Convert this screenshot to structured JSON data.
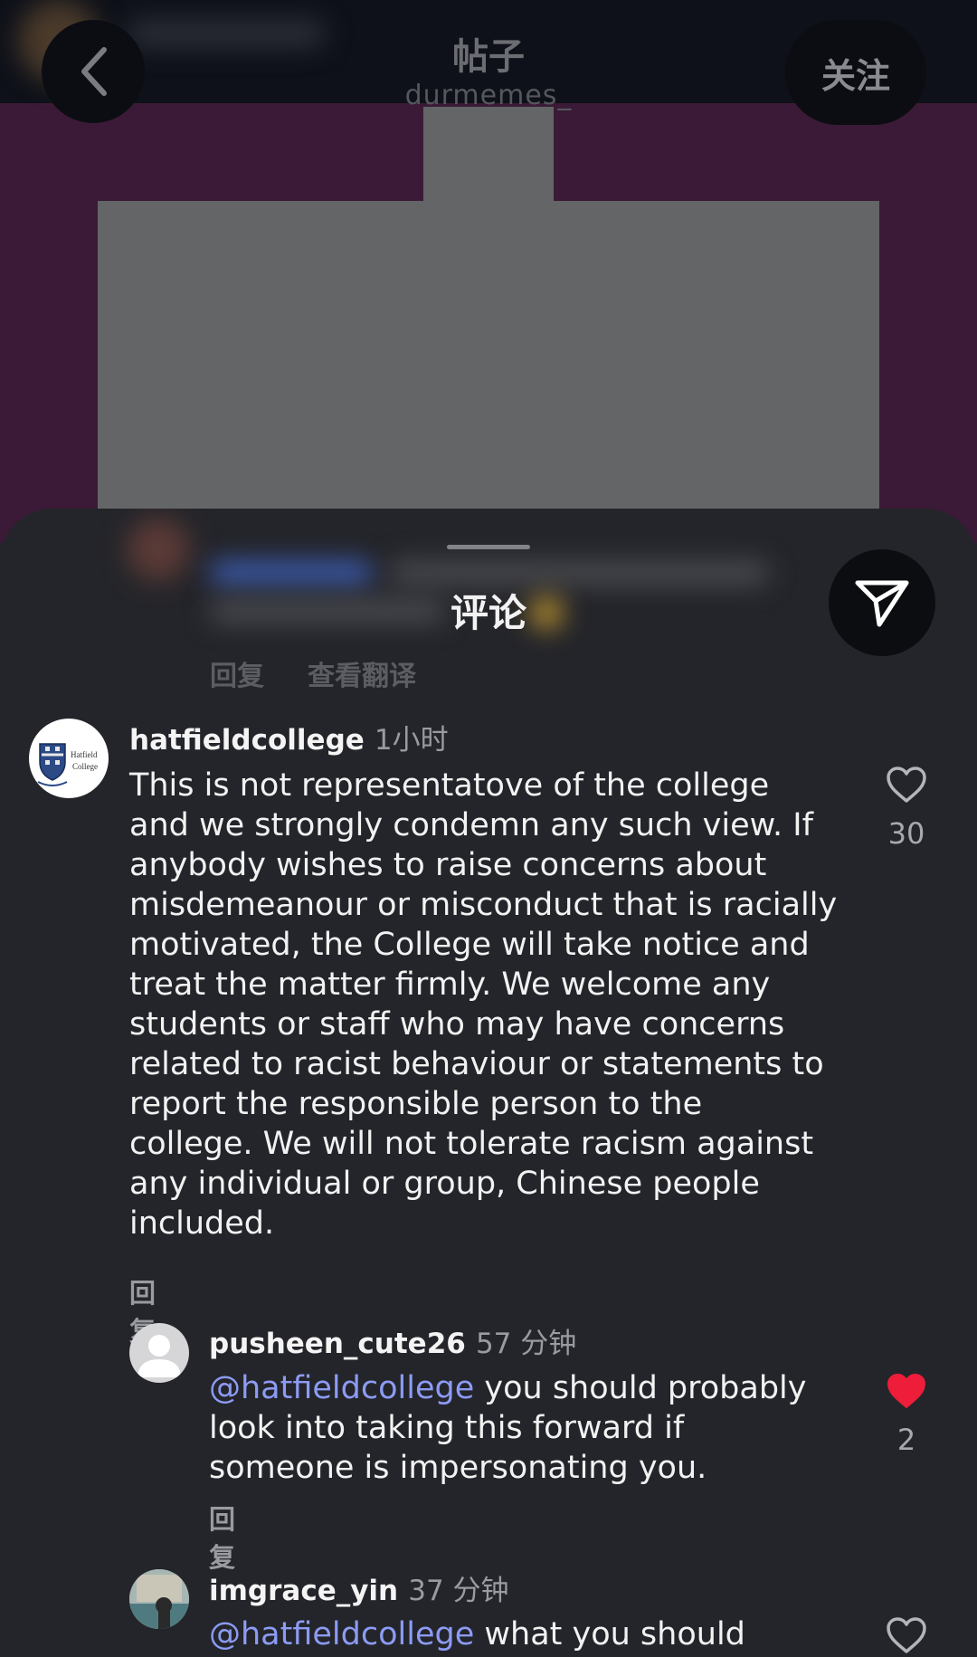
{
  "header": {
    "title": "帖子",
    "username": "durmemes_",
    "follow_label": "关注"
  },
  "sheet": {
    "title": "评论",
    "prev_actions": {
      "reply": "回复",
      "translate": "查看翻译"
    }
  },
  "comments": [
    {
      "username": "hatfieldcollege",
      "time": "1小时",
      "avatar_text": [
        "Hatfield",
        "College"
      ],
      "text": "This is not representatove of the college\nand we strongly condemn any such view. If\nanybody wishes to raise concerns about\nmisdemeanour or misconduct that is racially\nmotivated, the College will take notice and\ntreat the matter firmly. We welcome any\nstudents or staff who may have concerns\nrelated to racist behaviour or statements to\nreport the responsible person to the\ncollege. We will not tolerate racism against\nany individual or group, Chinese people\nincluded.",
      "reply_label": "回复",
      "likes": "30",
      "liked": false
    },
    {
      "username": "pusheen_cute26",
      "time": "57 分钟",
      "mention": "@hatfieldcollege",
      "text": " you should probably\nlook into taking this forward if\nsomeone is impersonating you.",
      "reply_label": "回复",
      "likes": "2",
      "liked": true
    },
    {
      "username": "imgrace_yin",
      "time": "37 分钟",
      "mention": "@hatfieldcollege",
      "text": " what you should",
      "liked": false
    }
  ],
  "colors": {
    "mention": "#8c9bf4",
    "liked_heart": "#ee1d3a",
    "sheet_bg": "#24252a"
  },
  "icons": [
    "back-chevron-icon",
    "share-send-icon",
    "heart-icon",
    "heart-filled-icon",
    "default-avatar-icon"
  ]
}
